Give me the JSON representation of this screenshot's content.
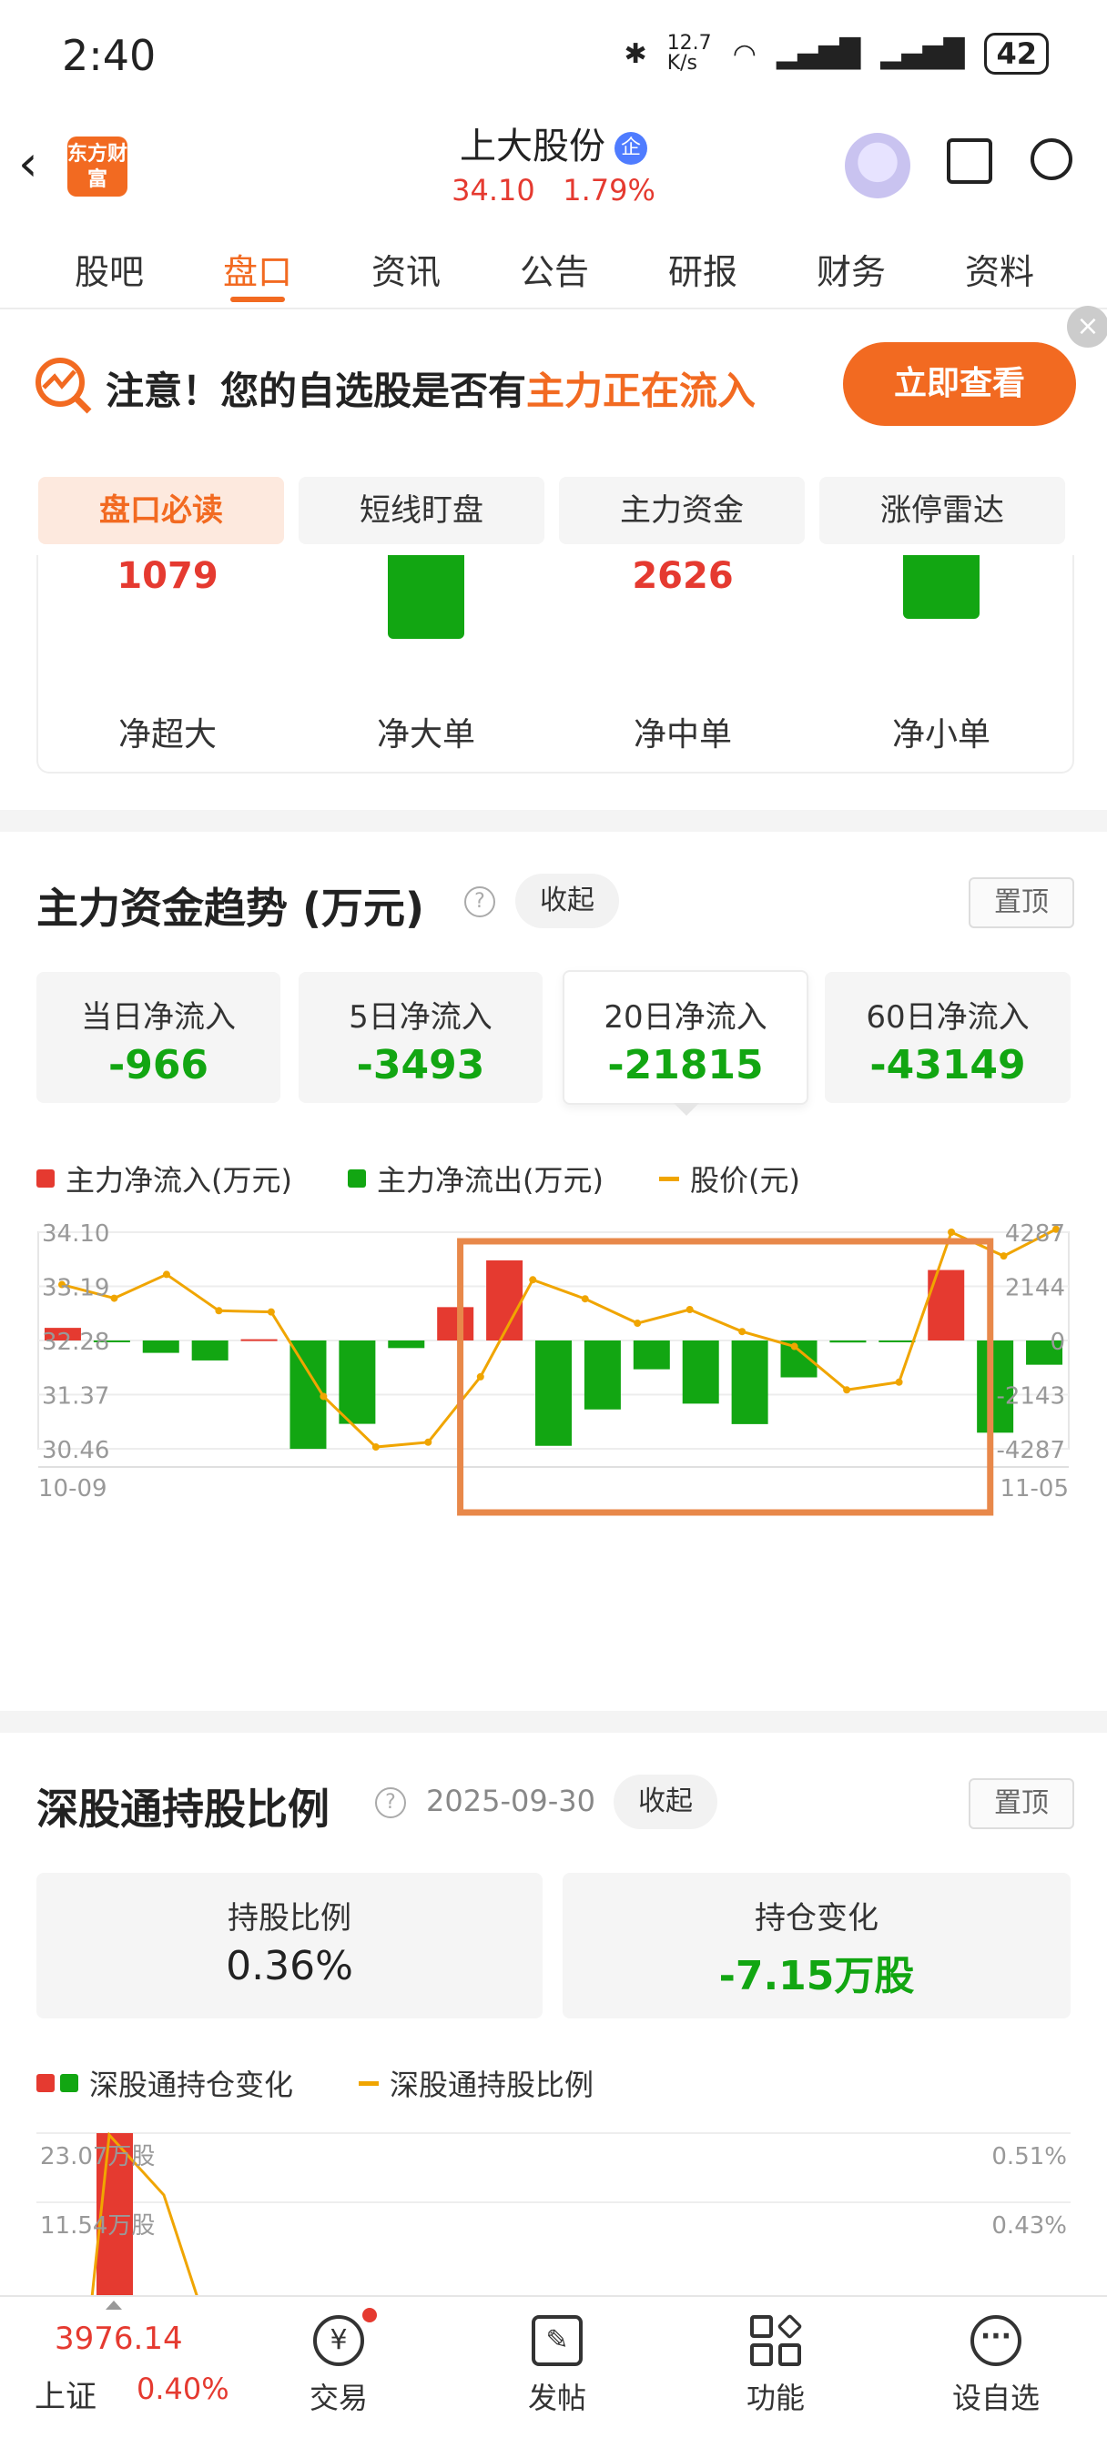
{
  "status_bar": {
    "time": "2:40",
    "net_speed": "12.7 K/s",
    "battery": "42"
  },
  "header": {
    "logo_text": "东方财富",
    "stock_name": "上大股份",
    "badge": "企",
    "price": "34.10",
    "change_pct": "1.79%"
  },
  "tabs": [
    {
      "label": "股吧",
      "active": false
    },
    {
      "label": "盘口",
      "active": true
    },
    {
      "label": "资讯",
      "active": false
    },
    {
      "label": "公告",
      "active": false
    },
    {
      "label": "研报",
      "active": false
    },
    {
      "label": "财务",
      "active": false
    },
    {
      "label": "资料",
      "active": false
    }
  ],
  "alert": {
    "prefix": "注意！您的自选股是否有",
    "highlight": "主力正在流入",
    "button": "立即查看"
  },
  "subtabs": [
    {
      "label": "盘口必读",
      "active": true
    },
    {
      "label": "短线盯盘",
      "active": false
    },
    {
      "label": "主力资金",
      "active": false
    },
    {
      "label": "涨停雷达",
      "active": false
    }
  ],
  "flow": [
    {
      "label": "净超大",
      "value": "1079"
    },
    {
      "label": "净大单",
      "value": ""
    },
    {
      "label": "净中单",
      "value": "2626"
    },
    {
      "label": "净小单",
      "value": ""
    }
  ],
  "trend": {
    "title": "主力资金趋势 (万元)",
    "collapse": "收起",
    "pin": "置顶",
    "cards": [
      {
        "label": "当日净流入",
        "value": "-966"
      },
      {
        "label": "5日净流入",
        "value": "-3493"
      },
      {
        "label": "20日净流入",
        "value": "-21815"
      },
      {
        "label": "60日净流入",
        "value": "-43149"
      }
    ],
    "legend": [
      "主力净流入(万元)",
      "主力净流出(万元)",
      "股价(元)"
    ]
  },
  "chart_data": {
    "type": "bar",
    "title": "",
    "x_start": "10-09",
    "x_end": "11-05",
    "left_ticks": [
      "34.10",
      "33.19",
      "32.28",
      "31.37",
      "30.46"
    ],
    "right_ticks": [
      "4287",
      "2144",
      "0",
      "-2143",
      "-4287"
    ],
    "ylim_left": [
      30.46,
      34.1
    ],
    "ylim_right": [
      -4287,
      4287
    ],
    "series": [
      {
        "name": "主力净流入(万元)",
        "values": [
          500,
          0,
          0,
          0,
          50,
          0,
          0,
          0,
          1320,
          3170,
          0,
          0,
          0,
          0,
          0,
          0,
          0,
          0,
          2790,
          0,
          0
        ]
      },
      {
        "name": "主力净流出(万元)",
        "values": [
          0,
          -30,
          -490,
          -790,
          0,
          -4290,
          -3300,
          -300,
          0,
          0,
          -4170,
          -2730,
          -1140,
          -2500,
          -3310,
          -1460,
          -80,
          0,
          0,
          -3650,
          -960
        ]
      },
      {
        "name": "股价(元)",
        "values": [
          33.22,
          32.99,
          33.39,
          32.78,
          32.76,
          31.34,
          30.49,
          30.57,
          31.67,
          33.3,
          32.98,
          32.57,
          32.8,
          32.43,
          32.18,
          31.45,
          31.58,
          34.1,
          33.7,
          34.15
        ]
      }
    ],
    "annotation": "orange box highlighting 10-20 to 11-03"
  },
  "holding": {
    "title": "深股通持股比例",
    "date": "2025-09-30",
    "collapse": "收起",
    "pin": "置顶",
    "cards": [
      {
        "label": "持股比例",
        "value": "0.36%",
        "color": "#222222"
      },
      {
        "label": "持仓变化",
        "value": "-7.15万股",
        "color": "#12a612"
      }
    ],
    "legend": [
      "深股通持仓变化",
      "深股通持股比例"
    ],
    "left_ticks": [
      "23.07万股",
      "11.54万股"
    ],
    "right_ticks": [
      "0.51%",
      "0.43%"
    ]
  },
  "bottom_nav": {
    "index_value": "3976.14",
    "index_name": "上证",
    "index_change": "0.40%",
    "items": [
      "交易",
      "发帖",
      "功能",
      "设自选"
    ]
  },
  "colors": {
    "accent": "#f26a21",
    "up": "#e53a30",
    "down": "#12a612",
    "price_line": "#f0a500"
  }
}
